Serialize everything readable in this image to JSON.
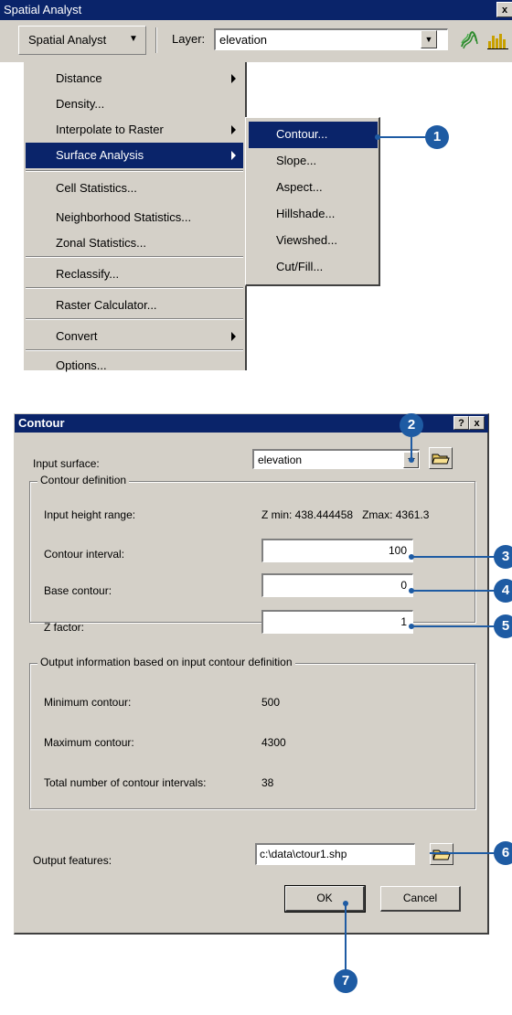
{
  "toolbar": {
    "title": "Spatial Analyst",
    "close_label": "x",
    "menu_button_label": "Spatial Analyst",
    "layer_label": "Layer:",
    "layer_value": "elevation",
    "icons": [
      "contour-tool-icon",
      "histogram-icon"
    ]
  },
  "main_menu": {
    "items": [
      {
        "label": "Distance",
        "submenu": true
      },
      {
        "label": "Density...",
        "submenu": false
      },
      {
        "label": "Interpolate to Raster",
        "submenu": true
      },
      {
        "label": "Surface Analysis",
        "submenu": true,
        "selected": true
      },
      {
        "label": "Cell Statistics...",
        "submenu": false
      },
      {
        "label": "Neighborhood Statistics...",
        "submenu": false
      },
      {
        "label": "Zonal Statistics...",
        "submenu": false
      },
      {
        "label": "Reclassify...",
        "submenu": false
      },
      {
        "label": "Raster Calculator...",
        "submenu": false
      },
      {
        "label": "Convert",
        "submenu": true
      },
      {
        "label": "Options...",
        "submenu": false
      }
    ]
  },
  "sub_menu": {
    "items": [
      {
        "label": "Contour...",
        "selected": true
      },
      {
        "label": "Slope..."
      },
      {
        "label": "Aspect..."
      },
      {
        "label": "Hillshade..."
      },
      {
        "label": "Viewshed..."
      },
      {
        "label": "Cut/Fill..."
      }
    ]
  },
  "callouts": [
    "1",
    "2",
    "3",
    "4",
    "5",
    "6",
    "7"
  ],
  "dialog": {
    "title": "Contour",
    "help_label": "?",
    "close_label": "x",
    "input_surface_label": "Input surface:",
    "input_surface_value": "elevation",
    "definition_group": {
      "title": "Contour definition",
      "height_range_label": "Input height range:",
      "height_range_value": "Z min: 438.444458   Zmax: 4361.3",
      "interval_label": "Contour interval:",
      "interval_value": "100",
      "base_label": "Base contour:",
      "base_value": "0",
      "zfactor_label": "Z factor:",
      "zfactor_value": "1"
    },
    "output_group": {
      "title": "Output information based on input contour definition",
      "min_label": "Minimum contour:",
      "min_value": "500",
      "max_label": "Maximum contour:",
      "max_value": "4300",
      "count_label": "Total number of contour intervals:",
      "count_value": "38"
    },
    "output_features_label": "Output features:",
    "output_features_value": "c:\\data\\ctour1.shp",
    "ok_label": "OK",
    "cancel_label": "Cancel"
  },
  "colors": {
    "title_bar": "#0a246a",
    "face": "#d4d0c8",
    "callout": "#1e5ba3"
  }
}
